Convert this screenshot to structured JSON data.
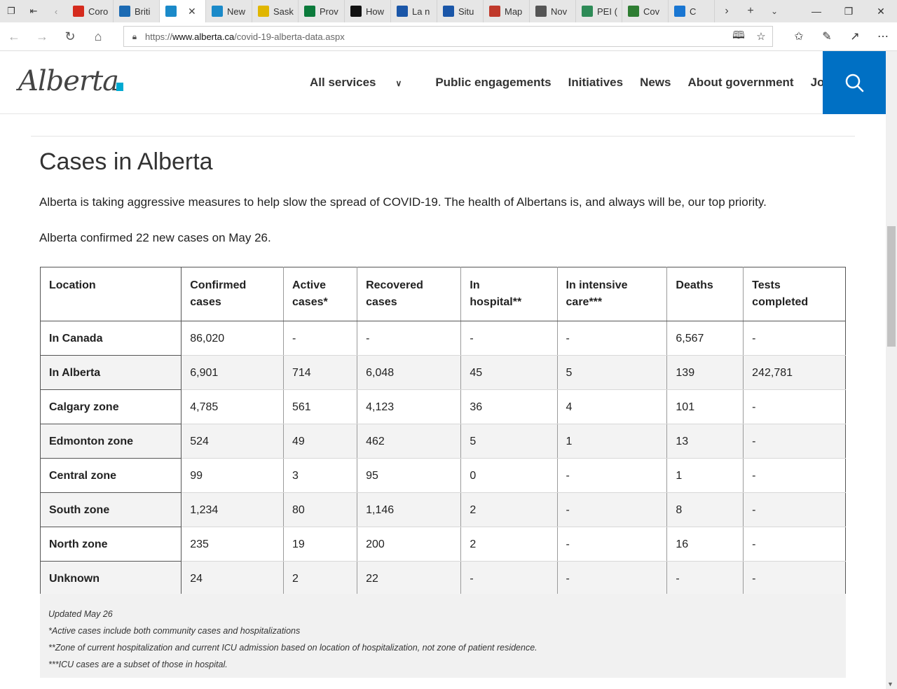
{
  "browser": {
    "tabs": [
      {
        "label": "Coro",
        "icon": "maple-leaf-icon",
        "color": "#d52b1e"
      },
      {
        "label": "Briti",
        "icon": "bc-icon",
        "color": "#1b6ab3"
      },
      {
        "label": "",
        "icon": "alberta-icon",
        "color": "#1b8ac9",
        "active": true
      },
      {
        "label": "New",
        "icon": "alberta-icon",
        "color": "#1b8ac9"
      },
      {
        "label": "Sask",
        "icon": "sask-icon",
        "color": "#e0b600"
      },
      {
        "label": "Prov",
        "icon": "manitoba-icon",
        "color": "#0b7a3b"
      },
      {
        "label": "How",
        "icon": "ontario-icon",
        "color": "#111111"
      },
      {
        "label": "La n",
        "icon": "quebec-icon",
        "color": "#1a56a8"
      },
      {
        "label": "Situ",
        "icon": "quebec-icon",
        "color": "#1a56a8"
      },
      {
        "label": "Map",
        "icon": "nb-icon",
        "color": "#c0392b"
      },
      {
        "label": "Nov",
        "icon": "ns-icon",
        "color": "#555555"
      },
      {
        "label": "PEI (",
        "icon": "pei-icon",
        "color": "#2e8b57"
      },
      {
        "label": "Cov",
        "icon": "globe-icon",
        "color": "#2e7d32"
      },
      {
        "label": "C",
        "icon": "nl-icon",
        "color": "#1976d2"
      }
    ],
    "url_prefix": "https://",
    "url_host": "www.alberta.ca",
    "url_path": "/covid-19-alberta-data.aspx"
  },
  "site": {
    "logo": "Alberta",
    "nav": [
      "All services",
      "Public engagements",
      "Initiatives",
      "News",
      "About government",
      "Jobs"
    ]
  },
  "content": {
    "title": "Cases in Alberta",
    "intro": "Alberta is taking aggressive measures to help slow the spread of COVID-19. The health of Albertans is, and always will be, our top priority.",
    "confirmed": "Alberta confirmed 22 new cases on May 26."
  },
  "table": {
    "headers": [
      [
        "Location",
        ""
      ],
      [
        "Confirmed",
        "cases"
      ],
      [
        "Active",
        "cases*"
      ],
      [
        "Recovered",
        "cases"
      ],
      [
        "In",
        "hospital**"
      ],
      [
        "In intensive",
        "care***"
      ],
      [
        "Deaths",
        ""
      ],
      [
        "Tests",
        "completed"
      ]
    ],
    "rows": [
      [
        "In Canada",
        "86,020",
        "-",
        "-",
        "-",
        "-",
        "6,567",
        "-"
      ],
      [
        "In Alberta",
        "6,901",
        "714",
        "6,048",
        "45",
        "5",
        "139",
        "242,781"
      ],
      [
        "Calgary zone",
        "4,785",
        "561",
        "4,123",
        "36",
        "4",
        "101",
        "-"
      ],
      [
        "Edmonton zone",
        "524",
        "49",
        "462",
        "5",
        "1",
        "13",
        "-"
      ],
      [
        "Central zone",
        "99",
        "3",
        "95",
        "0",
        "-",
        "1",
        "-"
      ],
      [
        "South zone",
        "1,234",
        "80",
        "1,146",
        "2",
        "-",
        "8",
        "-"
      ],
      [
        "North zone",
        "235",
        "19",
        "200",
        "2",
        "-",
        "16",
        "-"
      ],
      [
        "Unknown",
        "24",
        "2",
        "22",
        "-",
        "-",
        "-",
        "-"
      ]
    ]
  },
  "notes": [
    "Updated May 26",
    "*Active cases include both community cases and hospitalizations",
    "**Zone of current hospitalization and current ICU admission based on location of hospitalization, not zone of patient residence.",
    "***ICU cases are a subset of those in hospital."
  ]
}
